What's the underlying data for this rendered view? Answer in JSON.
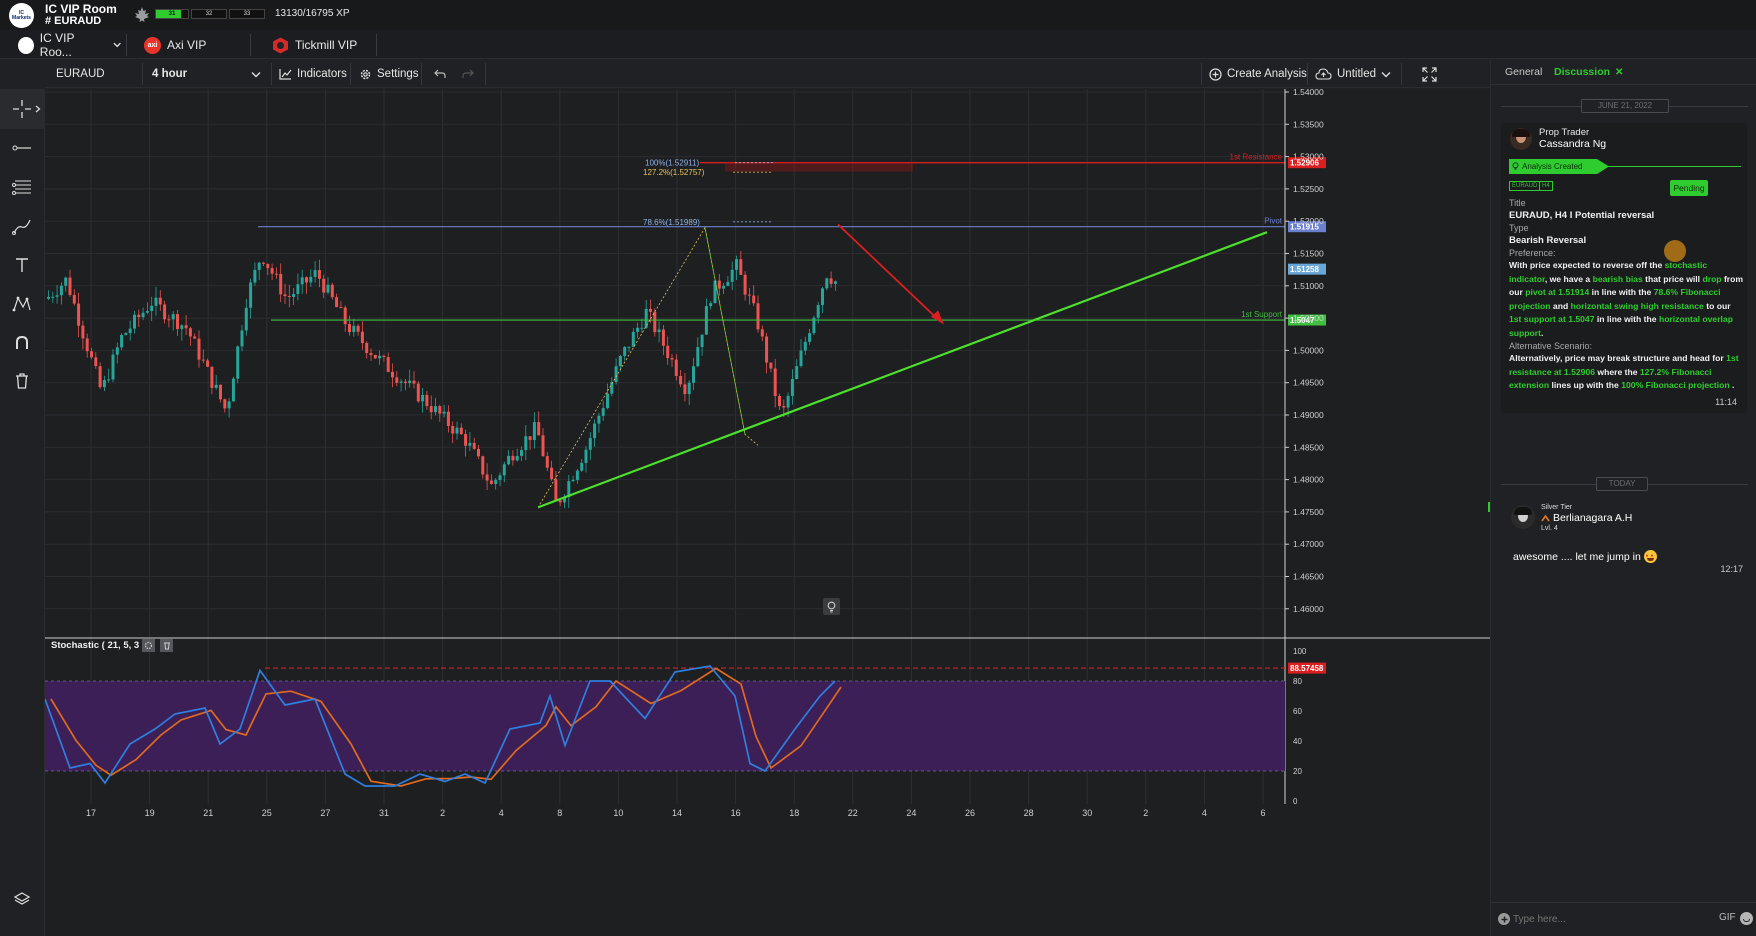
{
  "header": {
    "room_title": "IC VIP Room",
    "room_channel": "# EURAUD",
    "logo_text": "IC Markets",
    "xp_bars": [
      "31",
      "32",
      "33"
    ],
    "xp_text": "13130/16795 XP"
  },
  "tabs": [
    {
      "label": "IC VIP Roo..."
    },
    {
      "label": "Axi VIP",
      "icon_text": "axi"
    },
    {
      "label": "Tickmill VIP"
    }
  ],
  "toolbar": {
    "symbol": "EURAUD",
    "interval": "4 hour",
    "indicators_label": "Indicators",
    "settings_label": "Settings",
    "create_analysis_label": "Create Analysis",
    "layout_label": "Untitled"
  },
  "colors": {
    "bull": "#26a69a",
    "bear": "#ef5350",
    "resistance": "#d91f1f",
    "support": "#3fbf3f",
    "pivot": "#6b7fcf",
    "trendline": "#4ce12a",
    "stoch_k": "#2f7fe0",
    "stoch_d": "#e06a20",
    "stoch_band": "#3b1f56",
    "accent": "#2ecc2e"
  },
  "chart": {
    "price_ticks": [
      "1.54000",
      "1.53500",
      "1.53000",
      "1.52500",
      "1.52000",
      "1.51500",
      "1.51000",
      "1.50500",
      "1.50000",
      "1.49500",
      "1.49000",
      "1.48500",
      "1.48000",
      "1.47500",
      "1.47000",
      "1.46500",
      "1.46000"
    ],
    "date_ticks": [
      "17",
      "19",
      "21",
      "25",
      "27",
      "31",
      "2",
      "4",
      "8",
      "10",
      "14",
      "16",
      "18",
      "22",
      "24",
      "26",
      "28",
      "30",
      "2",
      "4",
      "6"
    ],
    "levels": [
      {
        "name": "1st Resistance",
        "price": "1.52906"
      },
      {
        "name": "Pivot",
        "price": "1.51915"
      },
      {
        "name": "1st Support",
        "price": "1.5047"
      }
    ],
    "current_price": "1.51258",
    "fib_labels": [
      "100%(1.52911)",
      "127.2%(1.52757)",
      "78.6%(1.51989)"
    ],
    "stochastic": {
      "title": "Stochastic ( 21, 5, 3 )",
      "ticks": [
        "100",
        "80",
        "60",
        "40",
        "20",
        "0"
      ],
      "marker_value": "88.57458"
    }
  },
  "panel": {
    "tab_general": "General",
    "tab_discussion": "Discussion",
    "date1": "JUNE 21, 2022",
    "date2": "TODAY",
    "post": {
      "role": "Prop Trader",
      "author": "Cassandra Ng",
      "banner": "Analysis Created",
      "tags": [
        "EURAUD",
        "H4"
      ],
      "status": "Pending",
      "title_label": "Title",
      "title_value": "EURAUD, H4 I Potential reversal",
      "type_label": "Type",
      "type_value": "Bearish Reversal",
      "preference_label": "Preference:",
      "pref": {
        "p1": "With price expected to reverse off the ",
        "h1": "stochastic indicator",
        "p2": ", we have a ",
        "h2": "bearish bias",
        "p3": " that price will ",
        "h3": "drop",
        "p4": " from our ",
        "h4": "pivot at 1.51914",
        "p5": " in line with the ",
        "h5": "78.6% Fibonacci projection",
        "p6": " and ",
        "h6": "horizontal swing high resistance",
        "p7": " to our ",
        "h7": "1st support at 1.5047",
        "p8": " in line with the ",
        "h8": "horizontal overlap support",
        "p9": "."
      },
      "alt_label": "Alternative Scenario:",
      "alt": {
        "p1": "Alternatively, price may break structure and head for ",
        "h1": "1st resistance at 1.52906",
        "p2": " where the ",
        "h2": "127.2% Fibonacci extension",
        "p3": " lines up with the ",
        "h3": "100% Fibonacci projection",
        "p4": " ."
      },
      "time": "11:14"
    },
    "reply": {
      "tier": "Silver Tier",
      "author": "Berlianagara A.H",
      "level": "Lvl. 4",
      "text": "awesome .... let me jump in",
      "time": "12:17"
    },
    "input_placeholder": "Type here...",
    "gif_label": "GIF"
  }
}
